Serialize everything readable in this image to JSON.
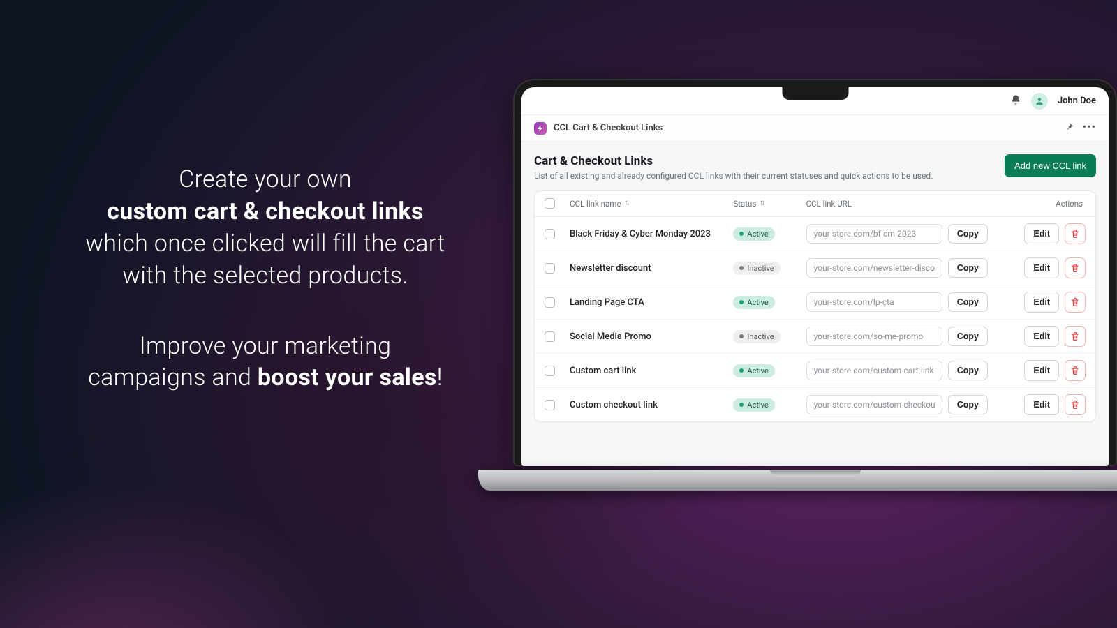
{
  "marketing": {
    "line1": "Create your own",
    "line2_strong": "custom cart & checkout links",
    "line3": "which once clicked will fill the cart",
    "line4": "with the selected products.",
    "line5": "Improve your marketing",
    "line6_pre": "campaigns and ",
    "line6_strong": "boost your sales",
    "line6_post": "!"
  },
  "topbar": {
    "user_name": "John Doe"
  },
  "appbar": {
    "title": "CCL Cart & Checkout Links"
  },
  "page": {
    "title": "Cart & Checkout Links",
    "subtitle": "List of all existing and already configured CCL links with their current statuses and quick actions to be used.",
    "primary_button": "Add new CCL link"
  },
  "table": {
    "headers": {
      "name": "CCL link name",
      "status": "Status",
      "url": "CCL link URL",
      "actions": "Actions"
    },
    "copy_label": "Copy",
    "edit_label": "Edit",
    "status_labels": {
      "active": "Active",
      "inactive": "Inactive"
    },
    "rows": [
      {
        "name": "Black Friday & Cyber Monday 2023",
        "status": "active",
        "url": "your-store.com/bf-cm-2023"
      },
      {
        "name": "Newsletter discount",
        "status": "inactive",
        "url": "your-store.com/newsletter-discount"
      },
      {
        "name": "Landing Page CTA",
        "status": "active",
        "url": "your-store.com/lp-cta"
      },
      {
        "name": "Social Media Promo",
        "status": "inactive",
        "url": "your-store.com/so-me-promo"
      },
      {
        "name": "Custom cart link",
        "status": "active",
        "url": "your-store.com/custom-cart-link"
      },
      {
        "name": "Custom checkout link",
        "status": "active",
        "url": "your-store.com/custom-checkout-link"
      }
    ]
  }
}
